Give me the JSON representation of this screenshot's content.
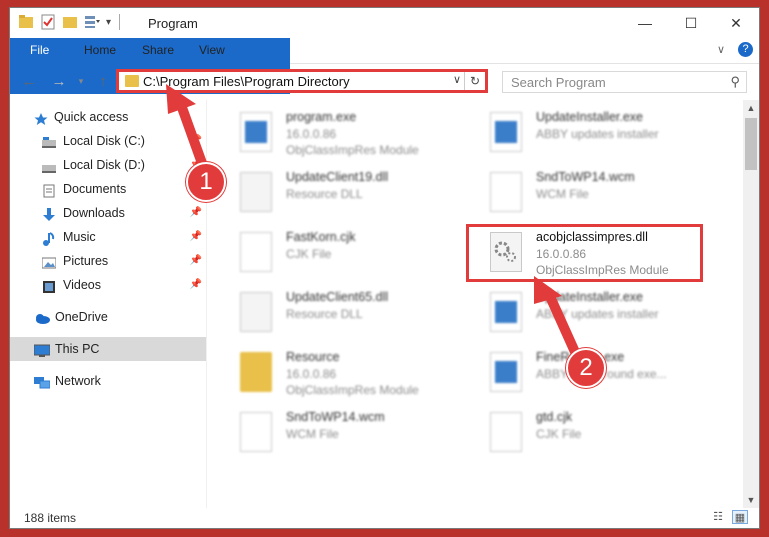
{
  "window": {
    "title": "Program",
    "controls": [
      "minimize",
      "maximize",
      "close"
    ]
  },
  "ribbon": {
    "tabs": [
      "File",
      "Home",
      "Share",
      "View"
    ]
  },
  "address": {
    "path": "C:\\Program Files\\Program Directory"
  },
  "search": {
    "placeholder": "Search Program"
  },
  "sidebar": {
    "items": [
      {
        "label": "Quick access",
        "icon": "star-icon"
      },
      {
        "label": "Local Disk (C:)",
        "icon": "drive-icon"
      },
      {
        "label": "Local Disk (D:)",
        "icon": "drive-icon"
      },
      {
        "label": "Documents",
        "icon": "documents-icon"
      },
      {
        "label": "Downloads",
        "icon": "download-icon"
      },
      {
        "label": "Music",
        "icon": "music-icon"
      },
      {
        "label": "Pictures",
        "icon": "pictures-icon"
      },
      {
        "label": "Videos",
        "icon": "videos-icon"
      },
      {
        "label": "OneDrive",
        "icon": "cloud-icon"
      },
      {
        "label": "This PC",
        "icon": "computer-icon"
      },
      {
        "label": "Network",
        "icon": "network-icon"
      }
    ]
  },
  "files": [
    {
      "name": "program.exe",
      "line1": "16.0.0.86",
      "line2": "ObjClassImpRes Module",
      "icon": "exe"
    },
    {
      "name": "UpdateInstaller.exe",
      "line1": "ABBY updates installer",
      "line2": "",
      "icon": "exe"
    },
    {
      "name": "UpdateClient19.dll",
      "line1": "Resource DLL",
      "line2": "",
      "icon": "gear"
    },
    {
      "name": "SndToWP14.wcm",
      "line1": "WCM File",
      "line2": "",
      "icon": "doc"
    },
    {
      "name": "FastKorn.cjk",
      "line1": "CJK File",
      "line2": "",
      "icon": "doc"
    },
    {
      "name": "acobjclassimpres.dll",
      "line1": "16.0.0.86",
      "line2": "ObjClassImpRes Module",
      "icon": "gear"
    },
    {
      "name": "UpdateClient65.dll",
      "line1": "Resource DLL",
      "line2": "",
      "icon": "gear"
    },
    {
      "name": "UpdateInstaller.exe",
      "line1": "ABBY updates installer",
      "line2": "",
      "icon": "exe"
    },
    {
      "name": "Resource",
      "line1": "16.0.0.86",
      "line2": "ObjClassImpRes Module",
      "icon": "folder"
    },
    {
      "name": "FineReader.exe",
      "line1": "ABBY background exe...",
      "line2": "",
      "icon": "exe"
    },
    {
      "name": "SndToWP14.wcm",
      "line1": "WCM File",
      "line2": "",
      "icon": "doc"
    },
    {
      "name": "gtd.cjk",
      "line1": "CJK File",
      "line2": "",
      "icon": "doc"
    }
  ],
  "status": {
    "item_count": "188 items"
  },
  "annotations": {
    "badge1": "1",
    "badge2": "2",
    "color": "#e23b3b"
  }
}
